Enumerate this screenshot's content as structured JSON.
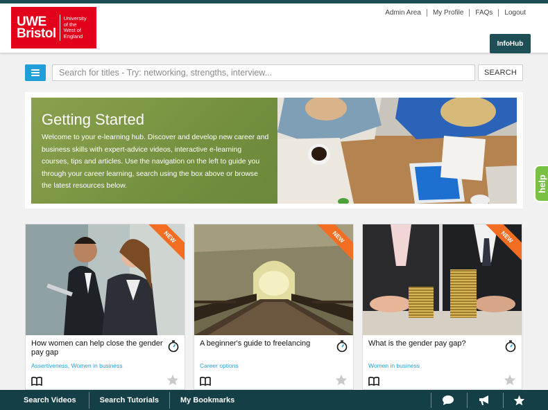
{
  "header": {
    "logo": {
      "brand": "UWE\nBristol",
      "sub": "University\nof the\nWest of\nEngland"
    },
    "links": [
      "Admin Area",
      "My Profile",
      "FAQs",
      "Logout"
    ],
    "infohub_label": "InfoHub"
  },
  "search": {
    "placeholder": "Search for titles - Try: networking, strengths, interview...",
    "button_label": "SEARCH"
  },
  "banner": {
    "title": "Getting Started",
    "text": "Welcome to your e-learning hub. Discover and develop new career and business skills with expert-advice videos, interactive e-learning courses, tips and articles. Use the navigation on the left to guide you through your career learning, search using the box above or browse the latest resources below."
  },
  "help_label": "help",
  "cards": [
    {
      "badge": "NEW",
      "title": "How women can help close the gender pay gap",
      "tags": "Assertiveness, Women in business"
    },
    {
      "badge": "NEW",
      "title": "A beginner's guide to freelancing",
      "tags": "Career options"
    },
    {
      "badge": "NEW",
      "title": "What is the gender pay gap?",
      "tags": "Women in business"
    }
  ],
  "bottom_nav": {
    "items": [
      "Search Videos",
      "Search Tutorials",
      "My Bookmarks"
    ],
    "icons": [
      "chat-bubble-icon",
      "megaphone-icon",
      "star-icon"
    ]
  },
  "colors": {
    "brand_red": "#e2001a",
    "dark_teal": "#153f46",
    "accent_blue": "#1f9ed8",
    "ribbon_orange": "#f36d22",
    "help_green": "#79c142"
  }
}
